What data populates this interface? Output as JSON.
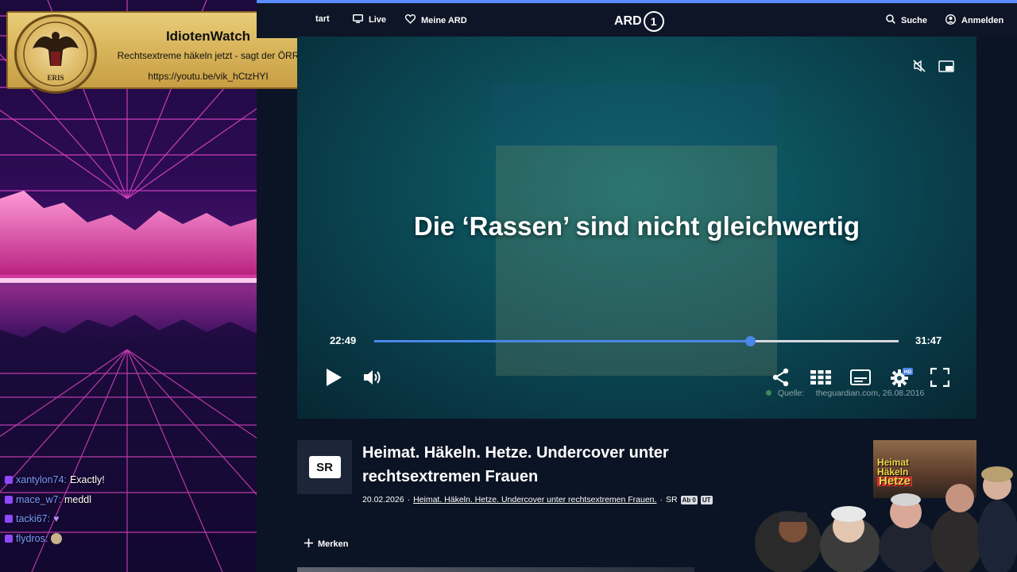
{
  "overlay": {
    "banner": {
      "title": "IdiotenWatch",
      "subtitle": "Rechtsextreme häkeln jetzt - sagt der ÖRR",
      "url": "https://youtu.be/vik_hCtzHYI"
    },
    "chat": [
      {
        "user": "xantylon74:",
        "message": "Exactly!"
      },
      {
        "user": "mace_w7:",
        "message": "meddl"
      },
      {
        "user": "tacki67:",
        "message": "♥"
      },
      {
        "user": "flydros:",
        "message": ""
      }
    ]
  },
  "nav": {
    "start": "tart",
    "live": "Live",
    "meine_ard": "Meine ARD",
    "logo": "ARD",
    "logo_one": "1",
    "search": "Suche",
    "login": "Anmelden"
  },
  "player": {
    "subtitle": "Die ‘Rassen’ sind nicht gleichwertig",
    "current_time": "22:49",
    "duration": "31:47",
    "progress_percent": 71.7,
    "source_label": "Quelle:",
    "source_value": "theguardian.com, 26.08.2016",
    "hd_badge": "HD"
  },
  "details": {
    "channel_logo": "SR",
    "title": "Heimat. Häkeln. Hetze. Undercover unter rechtsextremen Frauen",
    "date": "20.02.2026",
    "series_link": "Heimat. Häkeln. Hetze. Undercover unter rechtsextremen Frauen.",
    "channel": "SR",
    "tags": [
      "Ab 0",
      "UT"
    ],
    "merken": "Merken"
  },
  "thumbnail": {
    "line1": "Heimat",
    "line2": "Häkeln",
    "line3": "Hetze"
  }
}
